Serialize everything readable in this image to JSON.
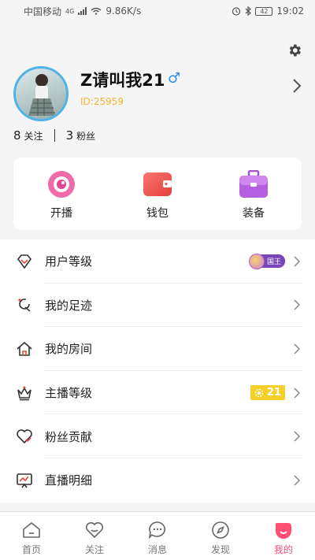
{
  "status_bar": {
    "carrier": "中国移动",
    "network": "4G",
    "speed": "9.86K/s",
    "battery": "42",
    "time": "19:02"
  },
  "profile": {
    "nickname": "Z请叫我21",
    "gender_symbol": "♂",
    "user_id": "ID:25959",
    "following_count": "8",
    "following_label": "关注",
    "fans_count": "3",
    "fans_label": "粉丝"
  },
  "quick_actions": [
    {
      "label": "开播",
      "icon": "live-camera-icon"
    },
    {
      "label": "钱包",
      "icon": "wallet-icon"
    },
    {
      "label": "装备",
      "icon": "equipment-box-icon"
    }
  ],
  "menu": [
    {
      "label": "用户等级",
      "icon": "diamond-icon",
      "badge_text": "国王"
    },
    {
      "label": "我的足迹",
      "icon": "footprint-icon"
    },
    {
      "label": "我的房间",
      "icon": "home-icon"
    },
    {
      "label": "主播等级",
      "icon": "crown-icon",
      "badge_text": "21"
    },
    {
      "label": "粉丝贡献",
      "icon": "heart-icon"
    },
    {
      "label": "直播明细",
      "icon": "chart-monitor-icon"
    }
  ],
  "bottom_nav": [
    {
      "label": "首页",
      "icon": "home-tab-icon"
    },
    {
      "label": "关注",
      "icon": "follow-tab-icon"
    },
    {
      "label": "消息",
      "icon": "message-tab-icon"
    },
    {
      "label": "发现",
      "icon": "discover-tab-icon"
    },
    {
      "label": "我的",
      "icon": "mine-tab-icon",
      "active": true
    }
  ],
  "colors": {
    "accent": "#ff4f73",
    "id_gold": "#f2b531",
    "gender_blue": "#2e8de8",
    "avatar_ring": "#4fb3e8"
  }
}
